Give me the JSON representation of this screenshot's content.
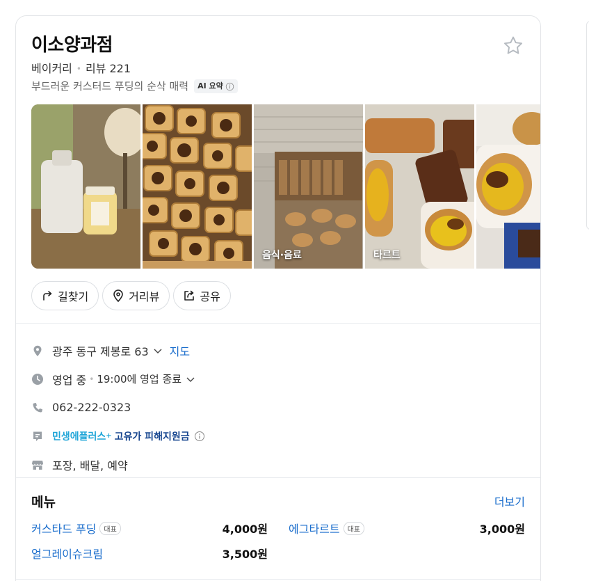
{
  "place": {
    "name": "이소양과점",
    "category": "베이커리",
    "reviews": "리뷰 221",
    "summary": "부드러운 커스터드 푸딩의 순삭 매력",
    "ai_badge": "AI 요약"
  },
  "photos": [
    {
      "label": ""
    },
    {
      "label": ""
    },
    {
      "label": "음식·음료"
    },
    {
      "label": "타르트"
    },
    {
      "label": ""
    }
  ],
  "actions": [
    {
      "label": "길찾기",
      "icon": "directions-icon"
    },
    {
      "label": "거리뷰",
      "icon": "location-pin-icon"
    },
    {
      "label": "공유",
      "icon": "share-icon"
    }
  ],
  "info": {
    "address": "광주 동구 제봉로 63",
    "map_link": "지도",
    "status": "영업 중",
    "hours": "19:00에 영업 종료",
    "phone": "062-222-0323",
    "promo_a": "민생에플러스",
    "promo_plus": "+",
    "promo_b": "고유가 피해지원금",
    "services": "포장, 배달, 예약"
  },
  "menu": {
    "title": "메뉴",
    "more": "더보기",
    "items": [
      {
        "name": "커스타드 푸딩",
        "tag": "대표",
        "price": "4,000원"
      },
      {
        "name": "에그타르트",
        "tag": "대표",
        "price": "3,000원"
      },
      {
        "name": "얼그레이슈크림",
        "tag": "",
        "price": "3,500원"
      }
    ]
  },
  "colors": {
    "link": "#1a6dcc",
    "promo_cyan": "#1fa5d8",
    "promo_navy": "#16458f",
    "icon_gray": "#9aa0a6"
  }
}
